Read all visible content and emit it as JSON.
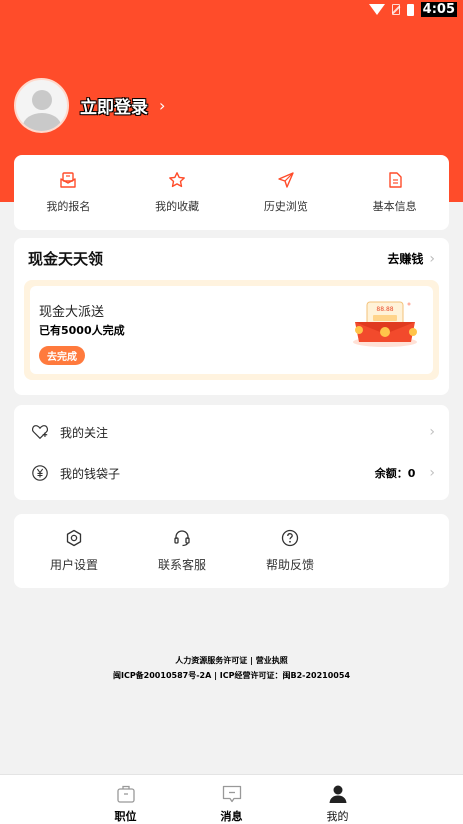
{
  "status_bar": {
    "time": "4:05"
  },
  "profile": {
    "login_text": "立即登录"
  },
  "quick_actions": [
    {
      "label": "我的报名",
      "icon": "signup-icon"
    },
    {
      "label": "我的收藏",
      "icon": "star-icon"
    },
    {
      "label": "历史浏览",
      "icon": "paper-plane-icon"
    },
    {
      "label": "基本信息",
      "icon": "document-icon"
    }
  ],
  "cash": {
    "title": "现金天天领",
    "more_label": "去赚钱",
    "promo_title": "现金大派送",
    "promo_sub": "已有5000人完成",
    "promo_button": "去完成",
    "packet_amount": "88.88"
  },
  "list": {
    "follow_label": "我的关注",
    "wallet_label": "我的钱袋子",
    "balance": "余额：0"
  },
  "tools": [
    {
      "label": "用户设置",
      "icon": "settings-icon"
    },
    {
      "label": "联系客服",
      "icon": "headset-icon"
    },
    {
      "label": "帮助反馈",
      "icon": "help-icon"
    }
  ],
  "footer": {
    "line1": "人力资源服务许可证 | 营业执照",
    "line2": "闽ICP备20010587号-2A | ICP经营许可证：闽B2-20210054"
  },
  "tabs": [
    {
      "label": "职位",
      "icon": "briefcase-icon"
    },
    {
      "label": "消息",
      "icon": "message-icon"
    },
    {
      "label": "我的",
      "icon": "user-icon"
    }
  ],
  "colors": {
    "brand": "#ff4c2a",
    "accent_orange": "#ff7a3d",
    "background": "#f2f2f2"
  }
}
